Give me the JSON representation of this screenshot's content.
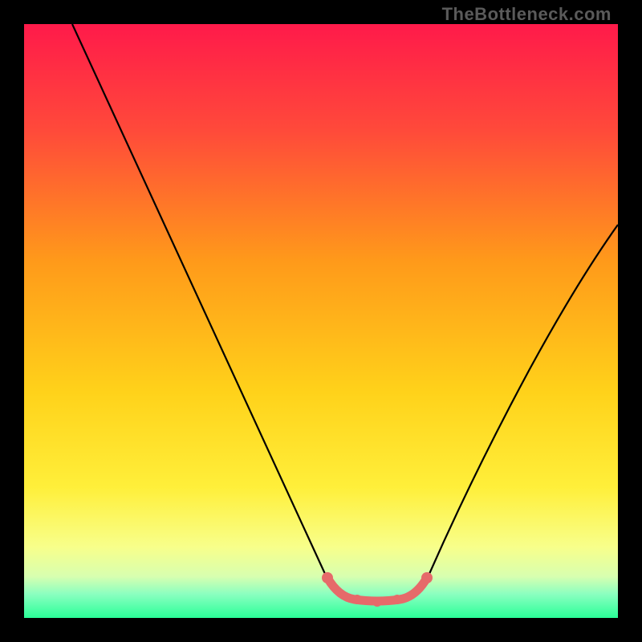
{
  "watermark": "TheBottleneck.com",
  "chart_data": {
    "type": "line",
    "title": "",
    "xlabel": "",
    "ylabel": "",
    "xlim": [
      0,
      100
    ],
    "ylim": [
      0,
      100
    ],
    "x": [
      0,
      5,
      10,
      15,
      20,
      25,
      30,
      35,
      40,
      45,
      50,
      52,
      55,
      58,
      60,
      62,
      65,
      70,
      75,
      80,
      85,
      90,
      95,
      100
    ],
    "values": [
      100,
      91,
      82,
      73,
      64,
      55,
      46,
      37,
      28,
      19,
      10,
      6,
      3,
      2,
      2,
      2,
      3,
      7,
      14,
      22,
      31,
      40,
      49,
      58
    ],
    "optimal_range_x": [
      50,
      65
    ],
    "optimal_value": 2,
    "background_gradient": {
      "top": "#ff1a4a",
      "mid_upper": "#ff9a1a",
      "mid": "#ffe81a",
      "lower": "#f8ff8a",
      "bottom": "#2aff98"
    },
    "highlight_color": "#e66a6a",
    "curve_color": "#000000"
  }
}
